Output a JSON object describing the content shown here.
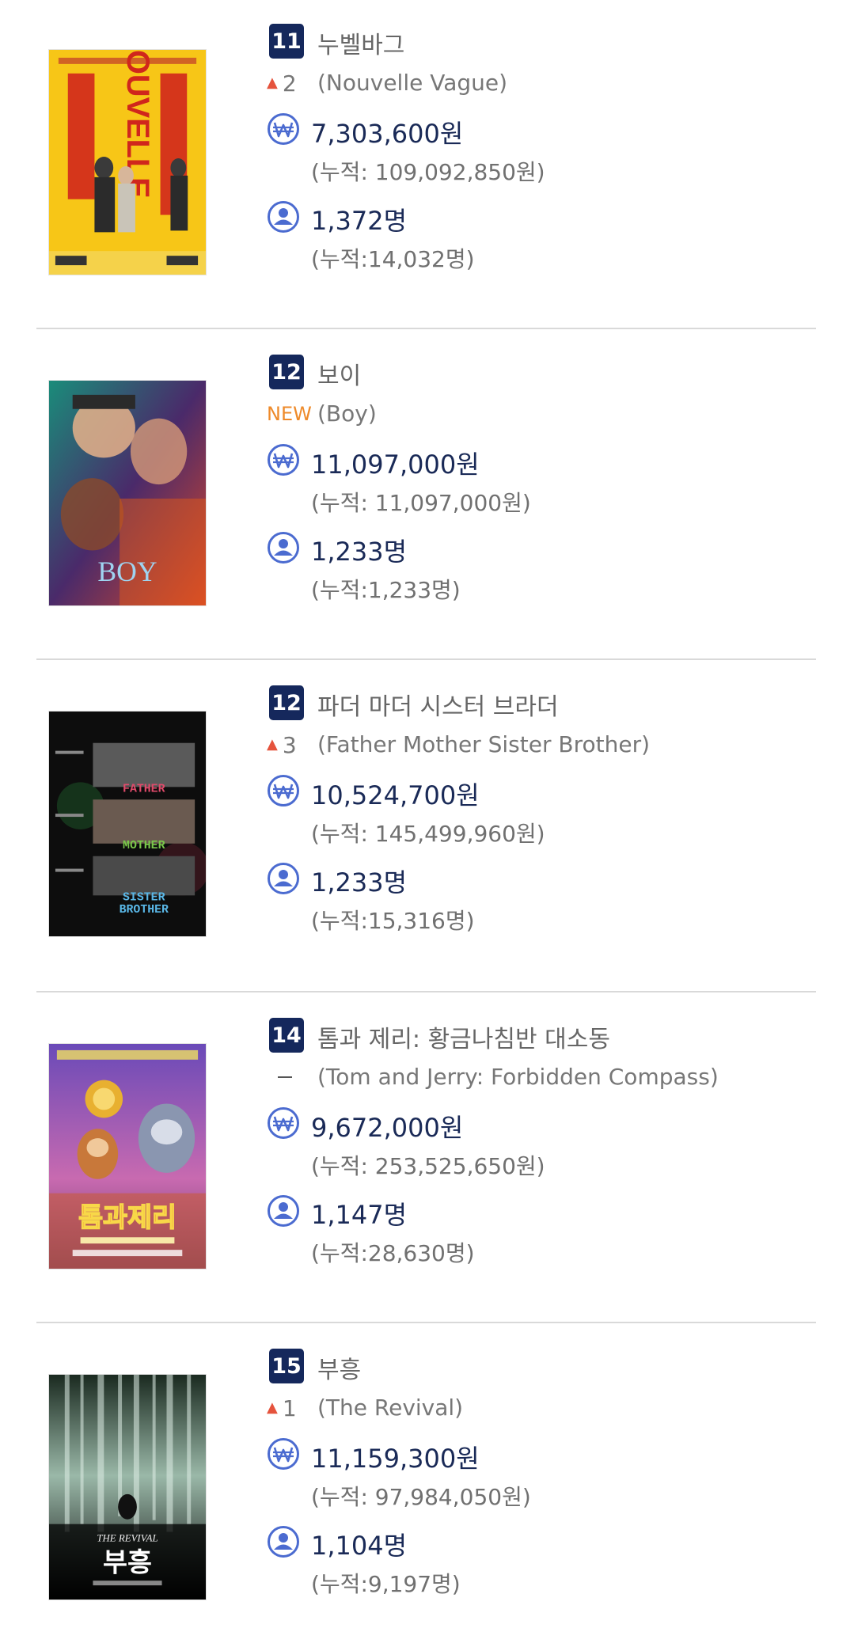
{
  "accent": "#15285c",
  "icon_color": "#4b6bd0",
  "arrow_color": "#e5533d",
  "new_color": "#ee8a2a",
  "movies": [
    {
      "rank": "11",
      "title_ko": "누벨바그",
      "change_type": "up",
      "change_value": "2",
      "title_en": "(Nouvelle Vague)",
      "sales": "7,303,600원",
      "sales_total": "(누적: 109,092,850원)",
      "audience": "1,372명",
      "audience_total": "(누적:14,032명)",
      "poster_icon": "nouvelle-vague-poster"
    },
    {
      "rank": "12",
      "title_ko": "보이",
      "change_type": "new",
      "change_value": "NEW",
      "title_en": "(Boy)",
      "sales": "11,097,000원",
      "sales_total": "(누적: 11,097,000원)",
      "audience": "1,233명",
      "audience_total": "(누적:1,233명)",
      "poster_icon": "boy-poster"
    },
    {
      "rank": "12",
      "title_ko": "파더 마더 시스터 브라더",
      "change_type": "up",
      "change_value": "3",
      "title_en": "(Father Mother Sister Brother)",
      "sales": "10,524,700원",
      "sales_total": "(누적: 145,499,960원)",
      "audience": "1,233명",
      "audience_total": "(누적:15,316명)",
      "poster_icon": "father-mother-sister-brother-poster"
    },
    {
      "rank": "14",
      "title_ko": "톰과 제리: 황금나침반 대소동",
      "change_type": "same",
      "change_value": "",
      "title_en": "(Tom and Jerry: Forbidden Compass)",
      "sales": "9,672,000원",
      "sales_total": "(누적: 253,525,650원)",
      "audience": "1,147명",
      "audience_total": "(누적:28,630명)",
      "poster_icon": "tom-and-jerry-poster"
    },
    {
      "rank": "15",
      "title_ko": "부흥",
      "change_type": "up",
      "change_value": "1",
      "title_en": "(The Revival)",
      "sales": "11,159,300원",
      "sales_total": "(누적: 97,984,050원)",
      "audience": "1,104명",
      "audience_total": "(누적:9,197명)",
      "poster_icon": "the-revival-poster"
    }
  ]
}
